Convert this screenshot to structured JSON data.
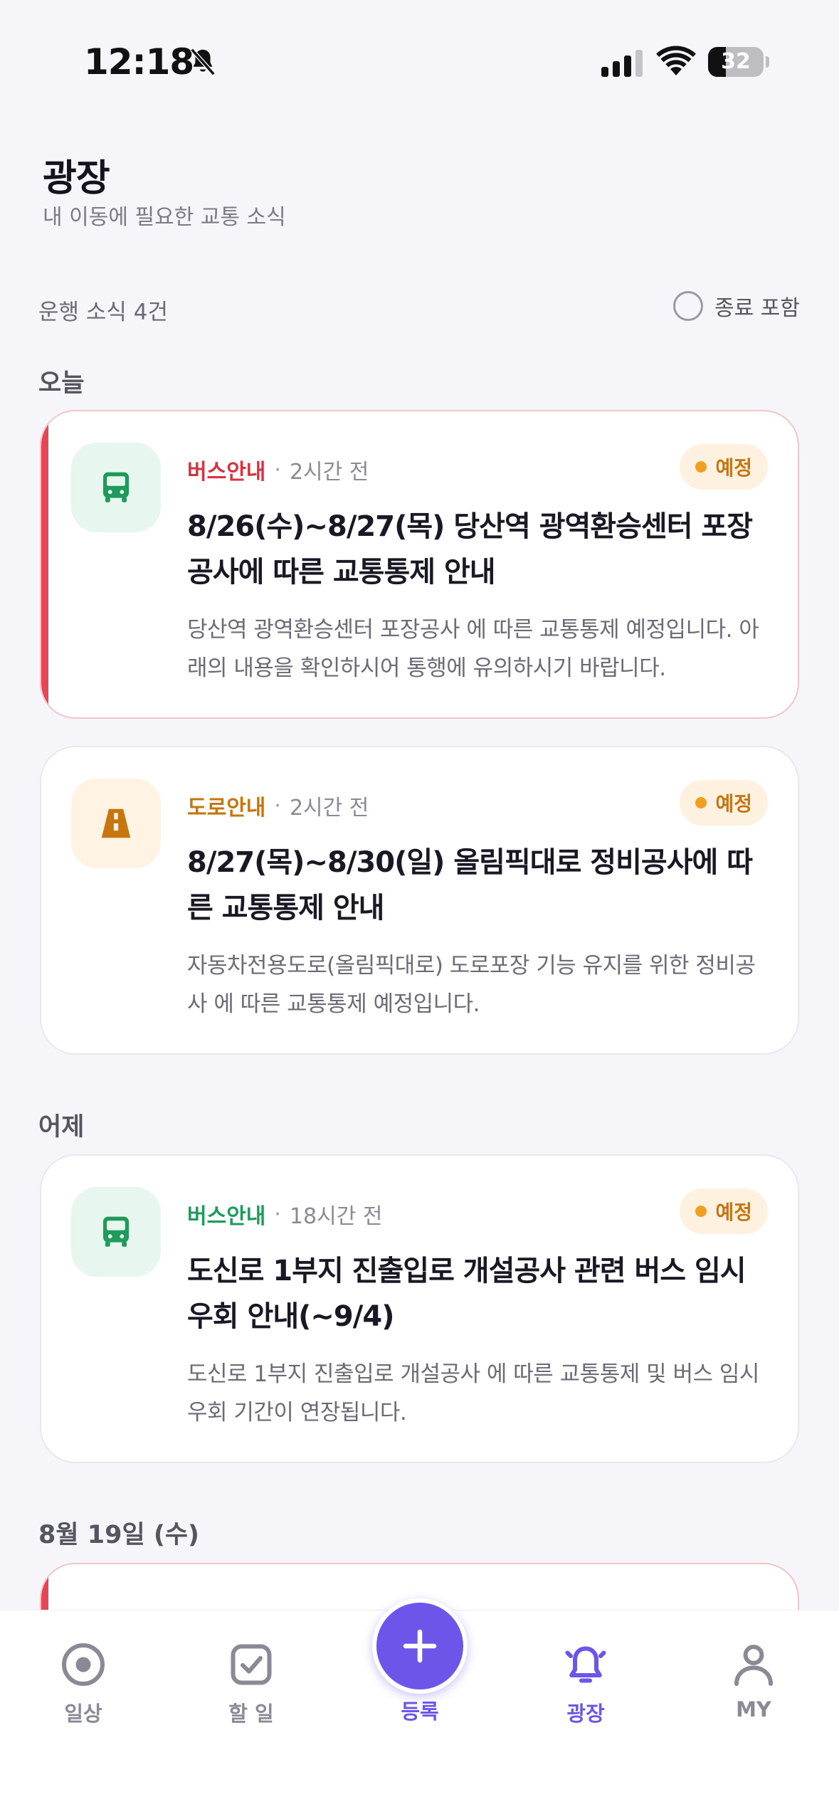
{
  "status_bar": {
    "time": "12:18",
    "battery": "32",
    "battery_level": 0.32
  },
  "header": {
    "title": "광장",
    "subtitle": "내 이동에 필요한 교통 소식"
  },
  "filter": {
    "count_label": "운행 소식 4건",
    "toggle_label": "종료 포함"
  },
  "sections": {
    "today": "오늘",
    "yesterday": "어제",
    "date_aug19": "8월 19일 (수)"
  },
  "cards": [
    {
      "category": "버스안내",
      "category_color": "#d6323f",
      "time": "2시간 전",
      "badge": "예정",
      "title": "8/26(수)~8/27(목) 당산역 광역환승센터 포장공사에 따른 교통통제 안내",
      "description": "당산역 광역환승센터 포장공사 에 따른 교통통제 예정입니다. 아래의 내용을 확인하시어 통행에 유의하시기 바랍니다.",
      "icon": "bus-icon"
    },
    {
      "category": "도로안내",
      "category_color": "#c7760f",
      "time": "2시간 전",
      "badge": "예정",
      "title": "8/27(목)~8/30(일) 올림픽대로 정비공사에 따른 교통통제 안내",
      "description": "자동차전용도로(올림픽대로) 도로포장 기능 유지를 위한 정비공사 에 따른 교통통제 예정입니다.",
      "icon": "road-icon"
    },
    {
      "category": "버스안내",
      "category_color": "#1e9a5a",
      "time": "18시간 전",
      "badge": "예정",
      "title": "도신로 1부지 진출입로 개설공사 관련 버스 임시우회 안내(~9/4)",
      "description": "도신로 1부지 진출입로 개설공사 에 따른 교통통제 및 버스 임시우회 기간이 연장됩니다.",
      "icon": "bus-icon"
    }
  ],
  "nav": {
    "daily": "일상",
    "todo": "할 일",
    "register": "등록",
    "plaza": "광장",
    "my": "MY"
  },
  "colors": {
    "accent": "#6c55e8",
    "urgent": "#e64553",
    "badge_text": "#c7760f"
  }
}
